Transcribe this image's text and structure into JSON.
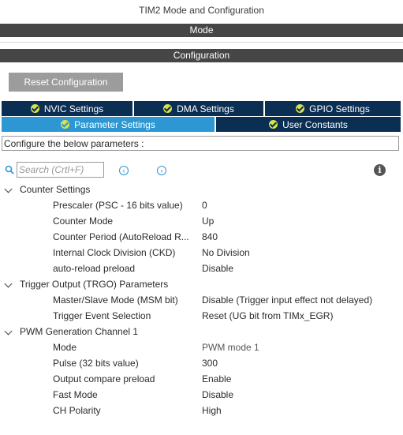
{
  "window": {
    "title": "TIM2 Mode and Configuration"
  },
  "bars": {
    "mode": "Mode",
    "configuration": "Configuration"
  },
  "reset_button": "Reset Configuration",
  "tabs_row1": [
    {
      "label": "NVIC Settings"
    },
    {
      "label": "DMA Settings"
    },
    {
      "label": "GPIO Settings"
    }
  ],
  "tabs_row2": [
    {
      "label": "Parameter Settings",
      "active": true
    },
    {
      "label": "User Constants",
      "active": false
    }
  ],
  "description": "Configure the below parameters :",
  "search": {
    "placeholder": "Search (Crtl+F)",
    "value": ""
  },
  "icons": {
    "prev": "chevron-left-circle-icon",
    "next": "chevron-right-circle-icon",
    "info": "info-icon",
    "tab_status": "check-circle-icon",
    "expand": "chevron-down-icon"
  },
  "colors": {
    "bar": "#464646",
    "tab_inactive": "#0b2e53",
    "tab_active": "#2c97d3",
    "check": "#d9e24a",
    "button": "#9c9c9c"
  },
  "sections": [
    {
      "label": "Counter Settings",
      "params": [
        {
          "name": "Prescaler (PSC - 16 bits value)",
          "value": "0"
        },
        {
          "name": "Counter Mode",
          "value": "Up"
        },
        {
          "name": "Counter Period (AutoReload R...",
          "value": "840"
        },
        {
          "name": "Internal Clock Division (CKD)",
          "value": "No Division"
        },
        {
          "name": "auto-reload preload",
          "value": "Disable"
        }
      ]
    },
    {
      "label": "Trigger Output (TRGO) Parameters",
      "params": [
        {
          "name": "Master/Slave Mode (MSM bit)",
          "value": "Disable (Trigger input effect not delayed)"
        },
        {
          "name": "Trigger Event Selection",
          "value": "Reset (UG bit from TIMx_EGR)"
        }
      ]
    },
    {
      "label": "PWM Generation Channel 1",
      "params": [
        {
          "name": "Mode",
          "value": "PWM mode 1"
        },
        {
          "name": "Pulse (32 bits value)",
          "value": "300"
        },
        {
          "name": "Output compare preload",
          "value": "Enable"
        },
        {
          "name": "Fast Mode",
          "value": "Disable"
        },
        {
          "name": "CH Polarity",
          "value": "High"
        }
      ]
    }
  ]
}
